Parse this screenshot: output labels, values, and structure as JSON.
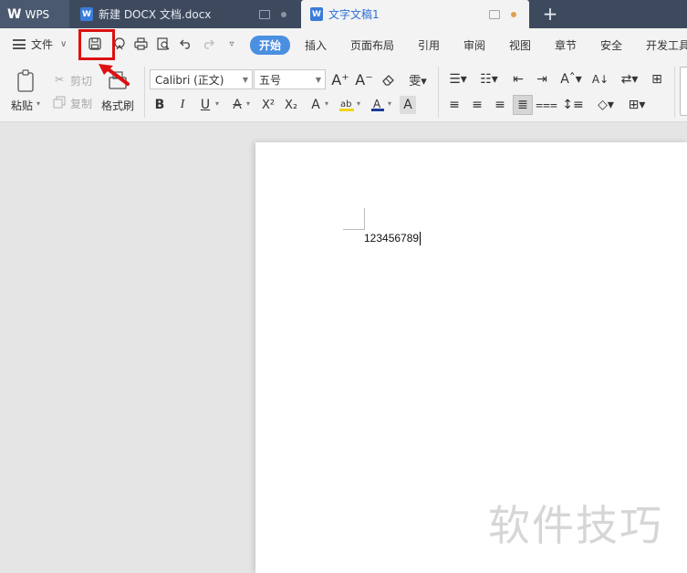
{
  "titlebar": {
    "app_tab": "WPS",
    "doc_tab_1": "新建 DOCX 文档.docx",
    "doc_tab_2": "文字文稿1",
    "new_tab": "+"
  },
  "menubar": {
    "file": "文件",
    "items": [
      "开始",
      "插入",
      "页面布局",
      "引用",
      "审阅",
      "视图",
      "章节",
      "安全",
      "开发工具"
    ],
    "active_index": 0
  },
  "ribbon": {
    "paste": "粘贴",
    "cut": "剪切",
    "copy": "复制",
    "format_painter": "格式刷",
    "font_name": "Calibri (正文)",
    "font_size": "五号",
    "bold": "B",
    "italic": "I",
    "underline": "U",
    "superscript": "X²",
    "subscript": "X₂"
  },
  "document": {
    "text": "123456789"
  },
  "watermark": "软件技巧",
  "colors": {
    "titlebar_bg": "#3d4a5e",
    "active_menu": "#4a8fe0",
    "highlight_box": "#dd1111"
  }
}
